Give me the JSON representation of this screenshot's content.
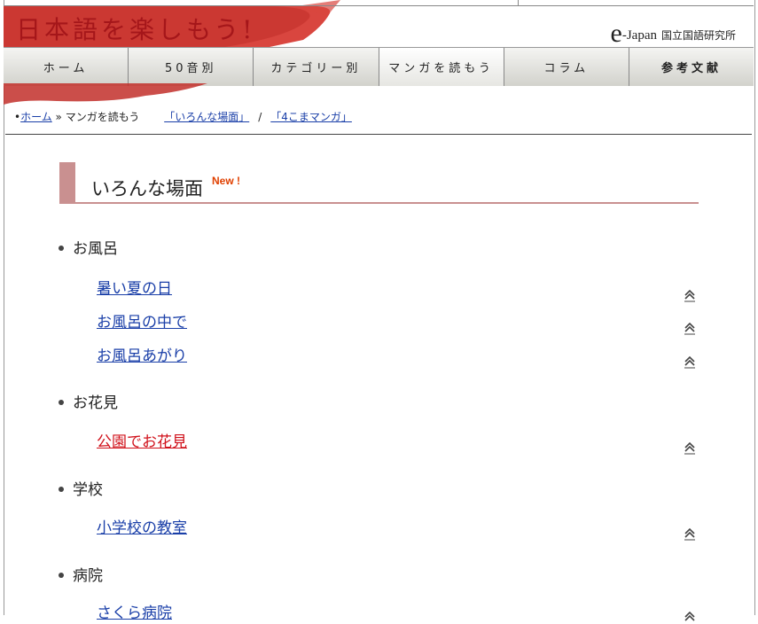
{
  "header": {
    "logo_text": "日本語を楽しもう!",
    "site_e": "e",
    "site_name": "-Japan",
    "site_org": "国立国語研究所"
  },
  "nav": [
    {
      "label": "ホーム"
    },
    {
      "label": "50音別"
    },
    {
      "label": "カテゴリー別"
    },
    {
      "label": "マンガを読もう"
    },
    {
      "label": "コラム"
    },
    {
      "label": "参考文献"
    }
  ],
  "breadcrumb": {
    "home": "ホーム",
    "current": "マンガを読もう",
    "link1": "「いろんな場面」",
    "separator": "/",
    "link2": "「4こまマンガ」"
  },
  "section": {
    "title": "いろんな場面",
    "badge": "New !"
  },
  "categories": [
    {
      "name": "お風呂",
      "items": [
        "暑い夏の日",
        "お風呂の中で",
        "お風呂あがり"
      ]
    },
    {
      "name": "お花見",
      "items": [
        "公園でお花見"
      ]
    },
    {
      "name": "学校",
      "items": [
        "小学校の教室"
      ]
    },
    {
      "name": "病院",
      "items": [
        "さくら病院"
      ]
    }
  ],
  "colors": {
    "accent_red": "#a5161a",
    "link_blue": "#1a3fa8",
    "visited_red": "#d0101a",
    "section_bar": "#c99090"
  }
}
